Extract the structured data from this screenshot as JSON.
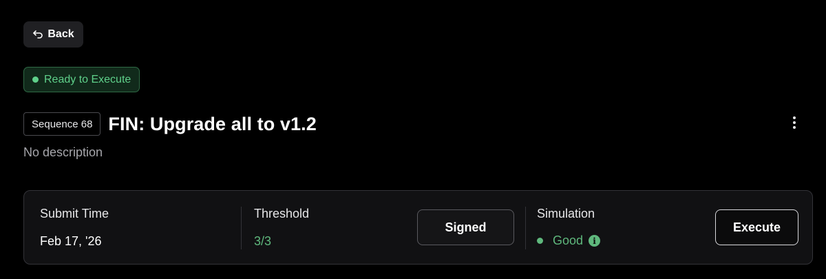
{
  "nav": {
    "back_label": "Back",
    "back_icon": "return-arrow-icon"
  },
  "status": {
    "label": "Ready to Execute",
    "color": "#5fd08a"
  },
  "proposal": {
    "sequence_label": "Sequence 68",
    "title": "FIN: Upgrade all to v1.2",
    "description": "No description",
    "more_icon": "vertical-ellipsis-icon"
  },
  "details": {
    "submit_time_label": "Submit Time",
    "submit_time_value": "Feb 17, '26",
    "threshold_label": "Threshold",
    "threshold_value": "3/3",
    "signed_button_label": "Signed",
    "simulation_label": "Simulation",
    "simulation_value": "Good",
    "simulation_icon": "info-icon",
    "execute_button_label": "Execute",
    "success_color": "#5fb87d"
  }
}
